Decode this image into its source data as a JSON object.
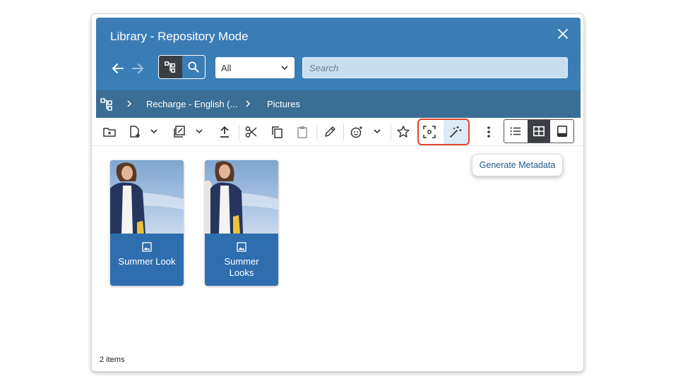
{
  "window": {
    "title": "Library - Repository Mode"
  },
  "search": {
    "scope_selected": "All",
    "placeholder": "Search"
  },
  "breadcrumb": {
    "items": [
      "Recharge - English (...",
      "Pictures"
    ]
  },
  "tooltip": {
    "text": "Generate Metadata"
  },
  "items": [
    {
      "name": "Summer Look",
      "type": "image"
    },
    {
      "name": "Summer Looks",
      "type": "image"
    }
  ],
  "status": {
    "item_count": "2 items"
  },
  "colors": {
    "header": "#3a7cb5",
    "breadcrumb_bar": "#3a6e95",
    "tile": "#2f6eae",
    "highlight": "#e0472a",
    "tooltip_text": "#1f5a8c"
  }
}
